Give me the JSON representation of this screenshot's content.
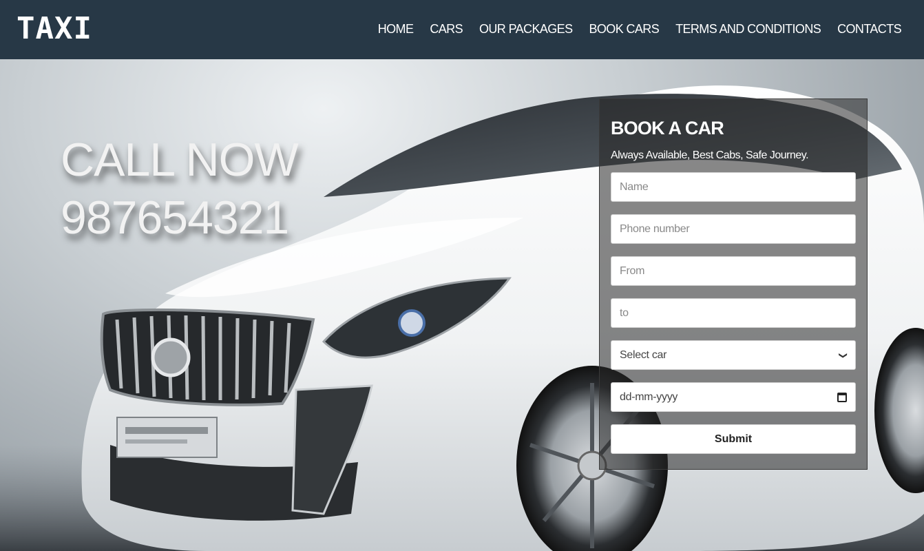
{
  "header": {
    "logo": "TAXI",
    "nav": [
      {
        "label": "HOME"
      },
      {
        "label": "CARS"
      },
      {
        "label": "OUR PACKAGES"
      },
      {
        "label": "BOOK CARS"
      },
      {
        "label": "TERMS AND CONDITIONS"
      },
      {
        "label": "CONTACTS"
      }
    ]
  },
  "hero": {
    "call_line1": "CALL NOW",
    "call_line2": "987654321",
    "image_icon": "white-sedan-car-photo"
  },
  "booking_form": {
    "title": "BOOK A CAR",
    "subtitle": "Always Available, Best Cabs, Safe Journey.",
    "name_placeholder": "Name",
    "phone_placeholder": "Phone number",
    "from_placeholder": "From",
    "to_placeholder": "to",
    "car_select_value": "Select car",
    "date_placeholder": "dd-mm-yyyy",
    "submit_label": "Submit"
  },
  "colors": {
    "header_bg": "#273846",
    "nav_text": "#ffffff",
    "form_overlay": "rgba(40,40,40,0.55)"
  }
}
